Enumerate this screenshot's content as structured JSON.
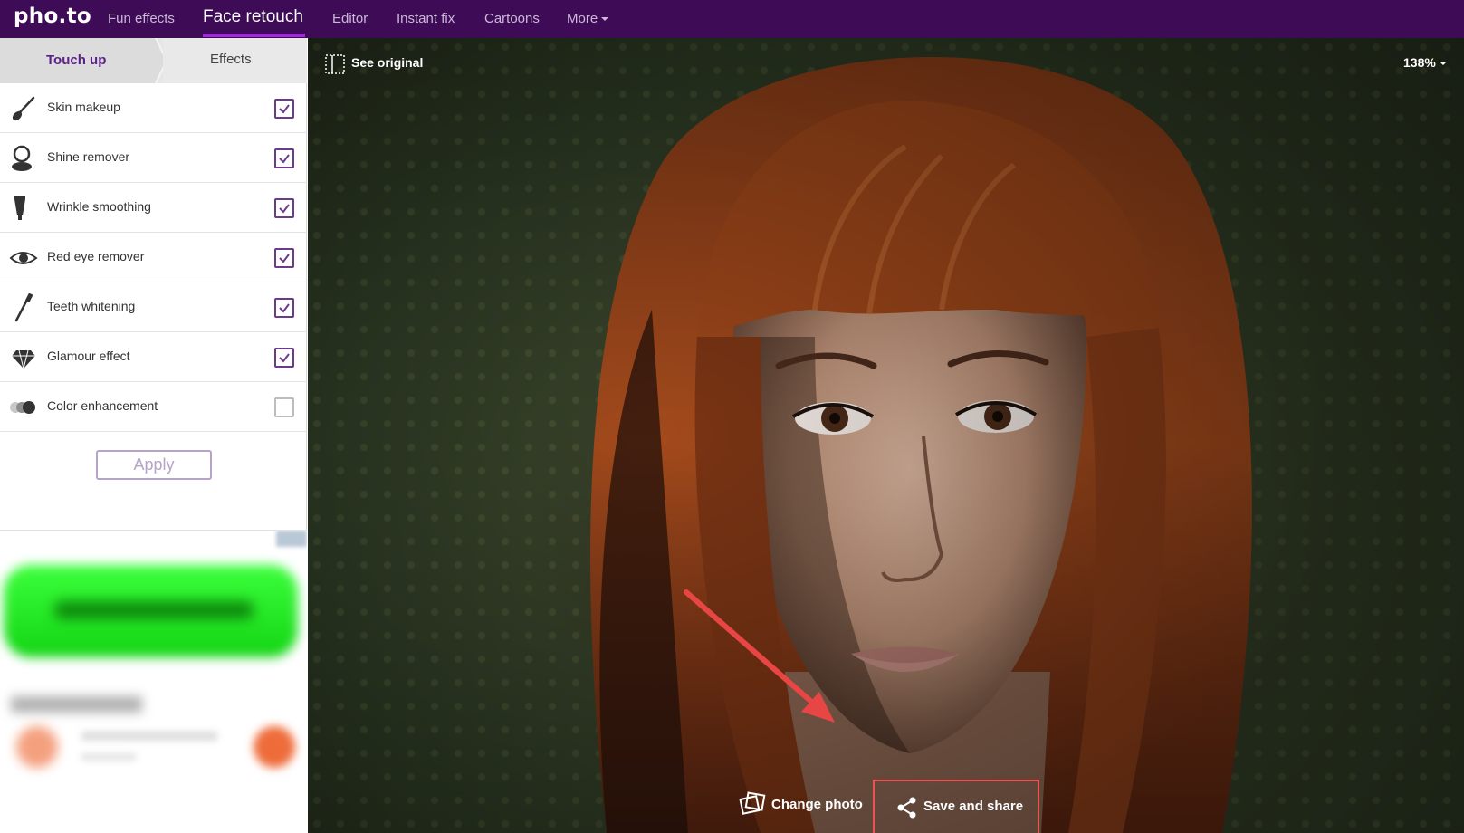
{
  "nav": {
    "logo": "pho.to",
    "items": [
      {
        "label": "Fun effects"
      },
      {
        "label": "Face retouch",
        "active": true
      },
      {
        "label": "Editor"
      },
      {
        "label": "Instant fix"
      },
      {
        "label": "Cartoons"
      },
      {
        "label": "More"
      }
    ]
  },
  "sidebar": {
    "tabs": [
      {
        "label": "Touch up",
        "active": true
      },
      {
        "label": "Effects"
      }
    ],
    "options": [
      {
        "label": "Skin makeup",
        "icon": "brush-icon",
        "checked": true
      },
      {
        "label": "Shine remover",
        "icon": "compact-mirror-icon",
        "checked": true
      },
      {
        "label": "Wrinkle smoothing",
        "icon": "cream-tube-icon",
        "checked": true
      },
      {
        "label": "Red eye remover",
        "icon": "eye-icon",
        "checked": true
      },
      {
        "label": "Teeth whitening",
        "icon": "toothbrush-icon",
        "checked": true
      },
      {
        "label": "Glamour effect",
        "icon": "diamond-icon",
        "checked": true
      },
      {
        "label": "Color enhancement",
        "icon": "color-circles-icon",
        "checked": false
      }
    ],
    "apply_label": "Apply"
  },
  "viewer": {
    "see_original_label": "See original",
    "zoom_label": "138%",
    "change_photo_label": "Change photo",
    "save_share_label": "Save and share"
  },
  "colors": {
    "nav_bg": "#3e0b57",
    "accent": "#5b1f86",
    "checkbox": "#6a3a8c",
    "highlight": "#e85555"
  }
}
